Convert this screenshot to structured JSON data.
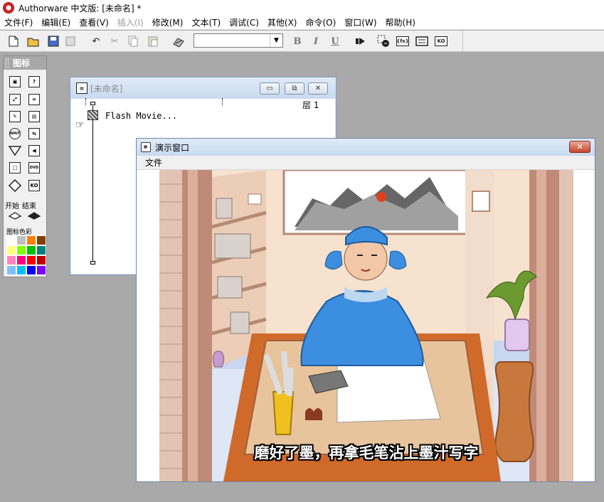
{
  "app": {
    "title": "Authorware 中文版: [未命名] *"
  },
  "menu": [
    "文件(F)",
    "编辑(E)",
    "查看(V)",
    "插入(I)",
    "修改(M)",
    "文本(T)",
    "调试(C)",
    "其他(X)",
    "命令(O)",
    "窗口(W)",
    "帮助(H)"
  ],
  "menu_disabled": [
    "插入(I)"
  ],
  "toolbar": {
    "font_box_value": "",
    "bold": "B",
    "italic": "I",
    "underline": "U"
  },
  "palette": {
    "title": "图标",
    "start_label": "开始",
    "end_label": "结束",
    "color_label": "图标色彩",
    "wait_label": "WAIT",
    "dvd_label": "DVD",
    "colors": [
      "#ffffff",
      "#c0c0c0",
      "#ff8000",
      "#804000",
      "#ffff80",
      "#80ff00",
      "#00c000",
      "#008080",
      "#ff80c0",
      "#ff0080",
      "#ff0000",
      "#c00000",
      "#80c0ff",
      "#00c0ff",
      "#0000ff",
      "#8000ff"
    ]
  },
  "design_window": {
    "title": "[未命名]",
    "layer_label": "层 1",
    "icon_label": "Flash Movie..."
  },
  "presentation_window": {
    "title": "演示窗口",
    "menu_file": "文件",
    "subtitle": "磨好了墨，再拿毛笔沾上墨汁写字"
  }
}
